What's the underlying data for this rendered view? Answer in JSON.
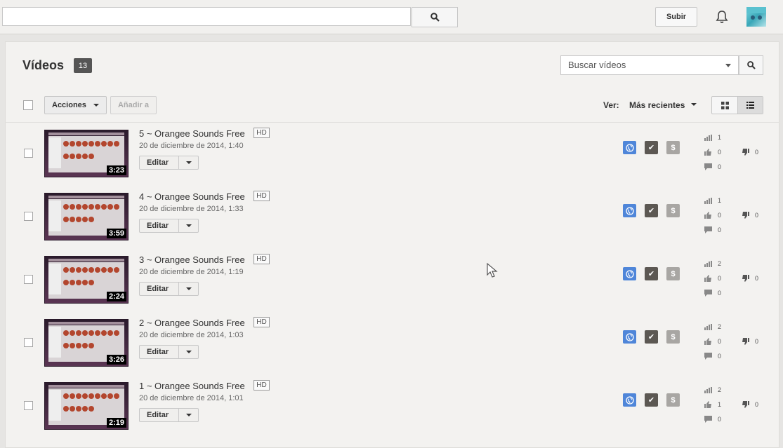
{
  "header": {
    "search_placeholder": "",
    "upload_label": "Subir"
  },
  "page": {
    "title": "Vídeos",
    "count": "13",
    "video_search_placeholder": "Buscar vídeos"
  },
  "toolbar": {
    "actions_label": "Acciones",
    "add_to_label": "Añadir a",
    "view_label": "Ver:",
    "sort_value": "Más recientes"
  },
  "videos": [
    {
      "title": "5 ~ Orangee Sounds Free",
      "hd": "HD",
      "date": "20 de diciembre de 2014, 1:40",
      "duration": "3:23",
      "edit": "Editar",
      "views": "1",
      "likes": "0",
      "dislikes": "0",
      "comments": "0"
    },
    {
      "title": "4 ~ Orangee Sounds Free",
      "hd": "HD",
      "date": "20 de diciembre de 2014, 1:33",
      "duration": "3:59",
      "edit": "Editar",
      "views": "1",
      "likes": "0",
      "dislikes": "0",
      "comments": "0"
    },
    {
      "title": "3 ~ Orangee Sounds Free",
      "hd": "HD",
      "date": "20 de diciembre de 2014, 1:19",
      "duration": "2:24",
      "edit": "Editar",
      "views": "2",
      "likes": "0",
      "dislikes": "0",
      "comments": "0"
    },
    {
      "title": "2 ~ Orangee Sounds Free",
      "hd": "HD",
      "date": "20 de diciembre de 2014, 1:03",
      "duration": "3:26",
      "edit": "Editar",
      "views": "2",
      "likes": "0",
      "dislikes": "0",
      "comments": "0"
    },
    {
      "title": "1 ~ Orangee Sounds Free",
      "hd": "HD",
      "date": "20 de diciembre de 2014, 1:01",
      "duration": "2:19",
      "edit": "Editar",
      "views": "2",
      "likes": "1",
      "dislikes": "0",
      "comments": "0"
    }
  ],
  "icons": {
    "search": "search-icon",
    "bell": "bell-icon",
    "grid": "grid-view-icon",
    "list": "list-view-icon",
    "public": "globe-icon",
    "check": "checkmark-icon",
    "money": "dollar-icon",
    "views": "bar-chart-icon",
    "like": "thumbs-up-icon",
    "dislike": "thumbs-down-icon",
    "comments": "comment-icon"
  },
  "colors": {
    "public": "#4f86d9",
    "check": "#5c5853",
    "money": "#a8a6a3",
    "badge": "#555555"
  },
  "status_glyphs": {
    "check": "✔",
    "money": "$"
  }
}
